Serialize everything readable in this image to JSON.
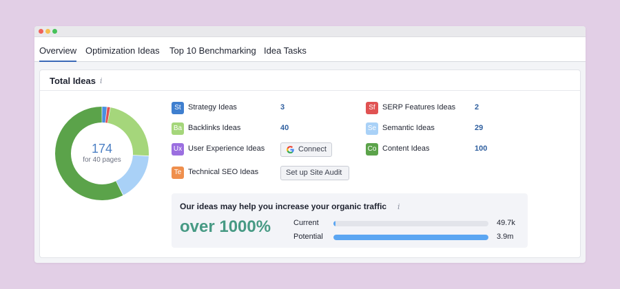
{
  "tabs": [
    {
      "label": "Overview",
      "active": true
    },
    {
      "label": "Optimization Ideas"
    },
    {
      "label": "Top 10 Benchmarking"
    },
    {
      "label": "Idea Tasks"
    }
  ],
  "card": {
    "title": "Total Ideas",
    "info_icon": "i",
    "total": "174",
    "subtitle": "for 40 pages"
  },
  "donut": [
    {
      "label": "Content Ideas",
      "value": 100,
      "color": "#5ba34a"
    },
    {
      "label": "Strategy Ideas",
      "value": 3,
      "color": "#4a8fe0"
    },
    {
      "label": "SERP Features Ideas",
      "value": 2,
      "color": "#e05252"
    },
    {
      "label": "Backlinks Ideas",
      "value": 40,
      "color": "#a5d67b"
    },
    {
      "label": "Semantic Ideas",
      "value": 29,
      "color": "#a9d1f7"
    }
  ],
  "ideas": {
    "strategy": {
      "abbr": "St",
      "label": "Strategy Ideas",
      "count": "3",
      "color": "#3f7fcf"
    },
    "backlinks": {
      "abbr": "Ba",
      "label": "Backlinks Ideas",
      "count": "40",
      "color": "#a5d67b"
    },
    "ux": {
      "abbr": "Ux",
      "label": "User Experience Ideas",
      "color": "#9b6fe0"
    },
    "tech": {
      "abbr": "Te",
      "label": "Technical SEO Ideas",
      "color": "#ef8f4d"
    },
    "serp": {
      "abbr": "Sf",
      "label": "SERP Features Ideas",
      "count": "2",
      "color": "#e05252"
    },
    "semantic": {
      "abbr": "Se",
      "label": "Semantic Ideas",
      "count": "29",
      "color": "#a9d1f7"
    },
    "content": {
      "abbr": "Co",
      "label": "Content Ideas",
      "count": "100",
      "color": "#5ba34a"
    }
  },
  "buttons": {
    "connect": "Connect",
    "site_audit": "Set up Site Audit"
  },
  "promo": {
    "title": "Our ideas may help you increase your organic traffic",
    "info_icon": "i",
    "headline": "over 1000%",
    "current_label": "Current",
    "current_value": "49.7k",
    "current_fraction": 0.013,
    "potential_label": "Potential",
    "potential_value": "3.9m",
    "potential_fraction": 1.0,
    "bar_color": "#5ba6f2"
  }
}
